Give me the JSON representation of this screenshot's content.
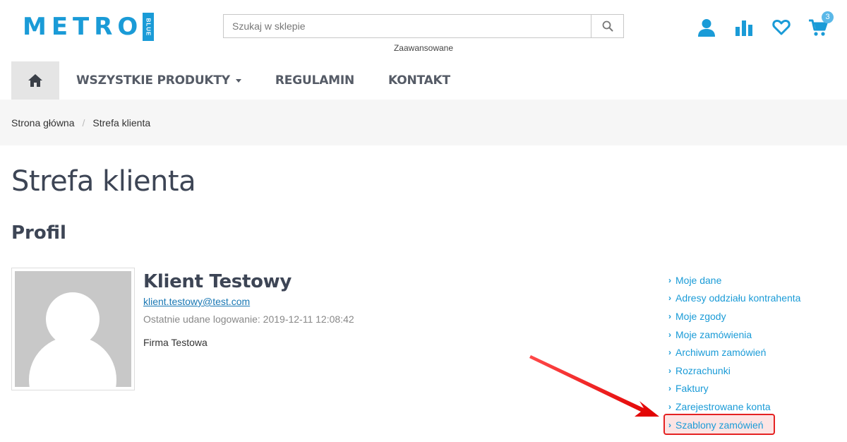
{
  "header": {
    "logo_text": "METRO",
    "logo_badge": "BLUE",
    "search_placeholder": "Szukaj w sklepie",
    "advanced_link": "Zaawansowane",
    "cart_count": "3",
    "icons": [
      "user-icon",
      "chart-icon",
      "heart-icon",
      "cart-icon",
      "search-icon",
      "home-icon"
    ]
  },
  "nav": {
    "items": [
      {
        "label": "WSZYSTKIE PRODUKTY"
      },
      {
        "label": "REGULAMIN"
      },
      {
        "label": "KONTAKT"
      }
    ]
  },
  "breadcrumb": {
    "items": [
      "Strona główna",
      "Strefa klienta"
    ],
    "separator": "/"
  },
  "page": {
    "title": "Strefa klienta",
    "section": "Profil"
  },
  "profile": {
    "name": "Klient Testowy",
    "email": "klient.testowy@test.com",
    "last_login": "Ostatnie udane logowanie: 2019-12-11 12:08:42",
    "company": "Firma Testowa"
  },
  "side_menu": {
    "items": [
      "Moje dane",
      "Adresy oddziału kontrahenta",
      "Moje zgody",
      "Moje zamówienia",
      "Archiwum zamówień",
      "Rozrachunki",
      "Faktury",
      "Zarejestrowane konta",
      "Szablony zamówień"
    ],
    "highlighted_index": 8
  },
  "colors": {
    "accent": "#1a9bd7",
    "highlight": "#e52222",
    "text_dark": "#3d4555"
  }
}
